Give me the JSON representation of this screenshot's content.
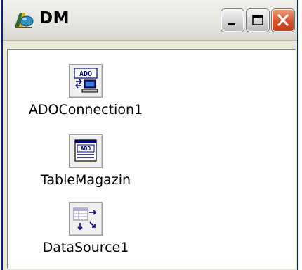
{
  "window": {
    "title": "DM",
    "controls": {
      "minimize_icon": "minimize-icon",
      "maximize_icon": "maximize-icon",
      "close_icon": "close-icon"
    }
  },
  "components": [
    {
      "label": "ADOConnection1",
      "icon": "ado-connection-icon"
    },
    {
      "label": "TableMagazin",
      "icon": "ado-table-icon"
    },
    {
      "label": "DataSource1",
      "icon": "datasource-icon"
    }
  ],
  "colors": {
    "frame": "#0a246a",
    "face": "#ece9d8",
    "close_button": "#d9502a"
  }
}
